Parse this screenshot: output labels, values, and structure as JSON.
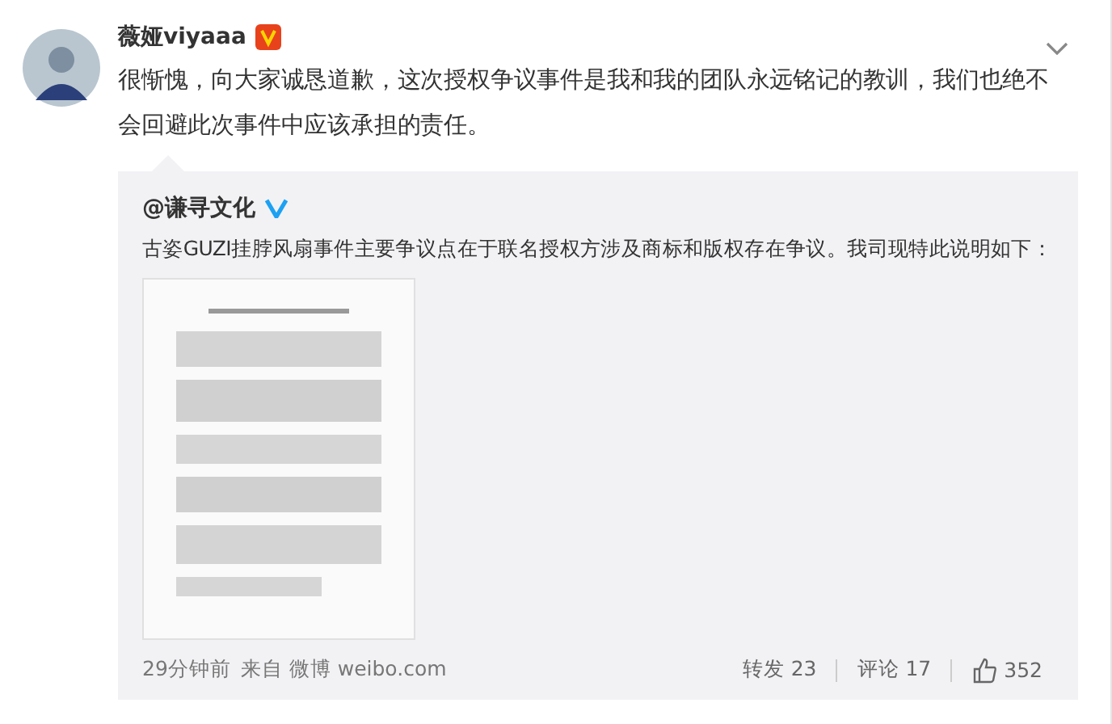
{
  "post": {
    "author": "薇娅viyaaa",
    "verified": true,
    "text": "很惭愧，向大家诚恳道歉，这次授权争议事件是我和我的团队永远铭记的教训，我们也绝不会回避此次事件中应该承担的责任。"
  },
  "repost": {
    "author": "@谦寻文化",
    "verified": true,
    "text": "古姿GUZI挂脖风扇事件主要争议点在于联名授权方涉及商标和版权存在争议。我司现特此说明如下：",
    "meta": {
      "time": "29分钟前",
      "source": "来自 微博 weibo.com"
    },
    "actions": [
      {
        "kind": "repost",
        "label": "转发 23"
      },
      {
        "kind": "comment",
        "label": "评论 17"
      },
      {
        "kind": "like",
        "label": "352"
      }
    ]
  }
}
